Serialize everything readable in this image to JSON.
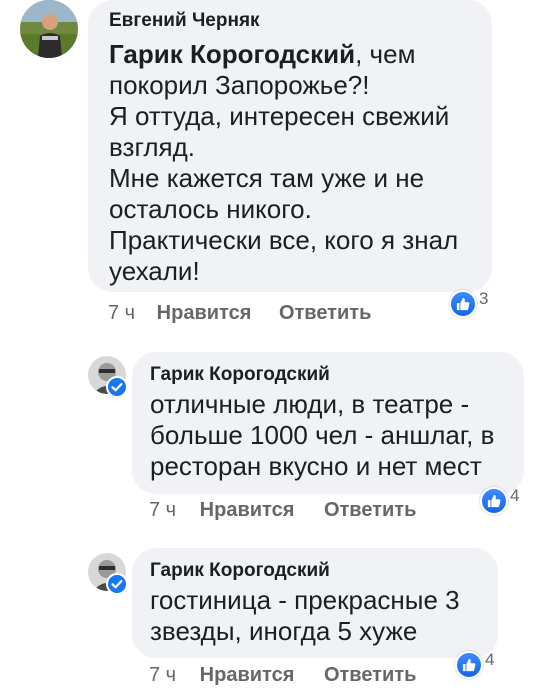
{
  "colors": {
    "bubble": "#f0f2f5",
    "meta": "#65676b",
    "like": "#1877f2",
    "text": "#1c1e21"
  },
  "comments": [
    {
      "author": "Евгений Черняк",
      "mention": "Гарик Корогодский",
      "text_lines": [
        ", чем",
        "покорил Запорожье?!",
        "Я оттуда, интересен свежий",
        "взгляд.",
        "Мне кажется там уже и не",
        "осталось никого.",
        "Практически все, кого я знал",
        "уехали!"
      ],
      "time": "7 ч",
      "like_label": "Нравится",
      "reply_label": "Ответить",
      "reactions": "3",
      "reaction_icon": "like-icon"
    },
    {
      "author": "Гарик Корогодский",
      "verified": true,
      "text_lines": [
        "отличные люди, в театре -",
        "больше 1000 чел - аншлаг, в",
        "ресторан вкусно и нет мест"
      ],
      "time": "7 ч",
      "like_label": "Нравится",
      "reply_label": "Ответить",
      "reactions": "4",
      "reaction_icon": "like-icon"
    },
    {
      "author": "Гарик Корогодский",
      "verified": true,
      "text_lines": [
        "гостиница - прекрасные 3",
        "звезды, иногда 5 хуже"
      ],
      "time": "7 ч",
      "like_label": "Нравится",
      "reply_label": "Ответить",
      "reactions": "4",
      "reaction_icon": "like-icon"
    }
  ]
}
